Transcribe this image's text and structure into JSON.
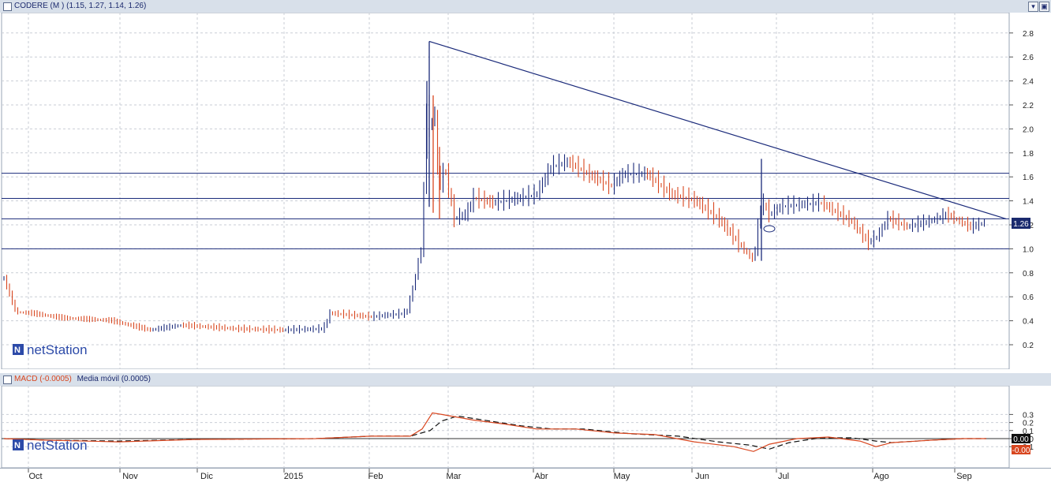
{
  "price_panel": {
    "title": "CODERE (M ) (1.15, 1.27, 1.14, 1.26)",
    "last_value_label": "1.26",
    "watermark": "netStation",
    "y_ticks": [
      "2.8",
      "2.6",
      "2.4",
      "2.2",
      "2.0",
      "1.8",
      "1.6",
      "1.4",
      "1.2",
      "1.0",
      "0.8",
      "0.6",
      "0.4",
      "0.2"
    ]
  },
  "macd_panel": {
    "title_macd": "MACD (-0.0005)",
    "title_ma": "Media móvil (0.0005)",
    "watermark": "netStation",
    "y_ticks": [
      "0.3",
      "0.2",
      "0.1",
      "0.0",
      "0.1"
    ],
    "value_box_1": "0.00",
    "value_box_2": "-0.00"
  },
  "x_axis": {
    "month_labels": [
      "Oct",
      "Nov",
      "Dic",
      "2015",
      "Feb",
      "Mar",
      "Abr",
      "May",
      "Jun",
      "Jul",
      "Ago",
      "Sep"
    ]
  },
  "controls": {
    "minimize": "▾",
    "maximize": "▣"
  },
  "colors": {
    "up_bar": "#1a2a7a",
    "down_bar": "#d8461f",
    "trendline": "#1a2a7a",
    "macd_line": "#d8461f",
    "ma_line": "#111111",
    "label_box": "#1a2a6e"
  },
  "chart_data": [
    {
      "type": "line",
      "title": "CODERE (M ) (1.15, 1.27, 1.14, 1.26)",
      "x": [
        "Oct",
        "Nov",
        "Dic",
        "2015",
        "Feb",
        "Mar",
        "Abr",
        "May",
        "Jun",
        "Jul",
        "Ago",
        "Sep"
      ],
      "series": [
        {
          "values": [
            0.45,
            0.4,
            0.33,
            0.32,
            0.44,
            1.35,
            1.62,
            1.58,
            1.05,
            1.32,
            1.1,
            1.22
          ]
        }
      ],
      "horizontal_lines": [
        1.63,
        1.42,
        1.25,
        1.0
      ],
      "trendline": {
        "from": 2.73,
        "to": 1.25
      },
      "ylim": [
        0.0,
        2.9
      ],
      "grid": true
    },
    {
      "type": "line",
      "series": [
        {
          "name": "MACD (-0.0005)",
          "values": [
            0.0,
            -0.03,
            -0.02,
            0.0,
            0.03,
            0.32,
            0.13,
            0.07,
            -0.12,
            0.0,
            -0.03,
            0.0
          ]
        },
        {
          "name": "Media móvil (0.0005)",
          "values": [
            0.0,
            -0.03,
            -0.02,
            0.0,
            0.03,
            0.27,
            0.13,
            0.07,
            -0.1,
            0.0,
            -0.02,
            0.0
          ]
        }
      ],
      "x": [
        "Oct",
        "Nov",
        "Dic",
        "2015",
        "Feb",
        "Mar",
        "Abr",
        "May",
        "Jun",
        "Jul",
        "Ago",
        "Sep"
      ],
      "ylim": [
        -0.15,
        0.35
      ],
      "grid": true
    }
  ]
}
